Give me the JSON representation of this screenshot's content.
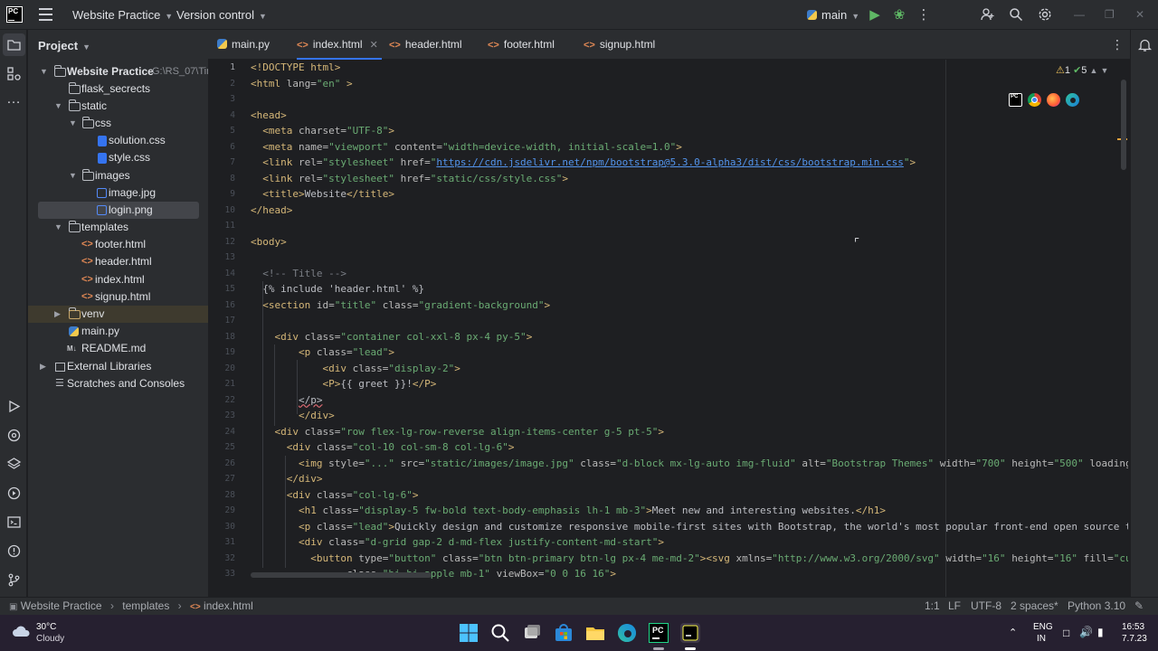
{
  "titlebar": {
    "app_logo": "PC",
    "project_name": "Website Practice",
    "vcs_label": "Version control",
    "run_config": "main",
    "icons": [
      "run-icon",
      "debug-icon",
      "more-vertical-icon",
      "add-user-icon",
      "search-icon",
      "settings-gear-icon"
    ]
  },
  "project_panel": {
    "title": "Project",
    "root": {
      "label": "Website Practice",
      "path": "G:\\RS_07\\Tim"
    },
    "items": [
      {
        "label": "flask_secrects",
        "kind": "folder"
      },
      {
        "label": "static",
        "kind": "folder"
      },
      {
        "label": "css",
        "kind": "folder"
      },
      {
        "label": "solution.css",
        "kind": "css"
      },
      {
        "label": "style.css",
        "kind": "css"
      },
      {
        "label": "images",
        "kind": "folder"
      },
      {
        "label": "image.jpg",
        "kind": "image"
      },
      {
        "label": "login.png",
        "kind": "image"
      },
      {
        "label": "templates",
        "kind": "folder"
      },
      {
        "label": "footer.html",
        "kind": "html"
      },
      {
        "label": "header.html",
        "kind": "html"
      },
      {
        "label": "index.html",
        "kind": "html"
      },
      {
        "label": "signup.html",
        "kind": "html"
      },
      {
        "label": "venv",
        "kind": "folder"
      },
      {
        "label": "main.py",
        "kind": "python"
      },
      {
        "label": "README.md",
        "kind": "markdown"
      },
      {
        "label": "External Libraries",
        "kind": "library"
      },
      {
        "label": "Scratches and Consoles",
        "kind": "scratch"
      }
    ]
  },
  "tabs": [
    {
      "label": "main.py",
      "kind": "python"
    },
    {
      "label": "index.html",
      "kind": "html",
      "active": true
    },
    {
      "label": "header.html",
      "kind": "html"
    },
    {
      "label": "footer.html",
      "kind": "html"
    },
    {
      "label": "signup.html",
      "kind": "html"
    }
  ],
  "inspections": {
    "warnings": "1",
    "ok": "5"
  },
  "editor_lines": [
    [
      [
        "tag",
        "<!DOCTYPE html>"
      ]
    ],
    [
      [
        "tag",
        "<html "
      ],
      [
        "at",
        "lang="
      ],
      [
        "st",
        "\"en\""
      ],
      [
        "tag",
        " >"
      ]
    ],
    [],
    [
      [
        "tag",
        "<head>"
      ]
    ],
    [
      [
        "tx",
        "  "
      ],
      [
        "tag",
        "<meta "
      ],
      [
        "at",
        "charset="
      ],
      [
        "st",
        "\"UTF-8\""
      ],
      [
        "tag",
        ">"
      ]
    ],
    [
      [
        "tx",
        "  "
      ],
      [
        "tag",
        "<meta "
      ],
      [
        "at",
        "name="
      ],
      [
        "st",
        "\"viewport\" "
      ],
      [
        "at",
        "content="
      ],
      [
        "st",
        "\"width=device-width, initial-scale=1.0\""
      ],
      [
        "tag",
        ">"
      ]
    ],
    [
      [
        "tx",
        "  "
      ],
      [
        "tag",
        "<link "
      ],
      [
        "at",
        "rel="
      ],
      [
        "st",
        "\"stylesheet\" "
      ],
      [
        "at",
        "href="
      ],
      [
        "st",
        "\""
      ],
      [
        "url",
        "https://cdn.jsdelivr.net/npm/bootstrap@5.3.0-alpha3/dist/css/bootstrap.min.css"
      ],
      [
        "st",
        "\""
      ],
      [
        "tag",
        ">"
      ]
    ],
    [
      [
        "tx",
        "  "
      ],
      [
        "tag",
        "<link "
      ],
      [
        "at",
        "rel="
      ],
      [
        "st",
        "\"stylesheet\" "
      ],
      [
        "at",
        "href="
      ],
      [
        "st",
        "\"static/css/style.css\""
      ],
      [
        "tag",
        ">"
      ]
    ],
    [
      [
        "tx",
        "  "
      ],
      [
        "tag",
        "<title>"
      ],
      [
        "tx",
        "Website"
      ],
      [
        "tag",
        "</title>"
      ]
    ],
    [
      [
        "tag",
        "</head>"
      ]
    ],
    [],
    [
      [
        "tag",
        "<body>"
      ]
    ],
    [],
    [
      [
        "cm",
        "  <!-- Title -->"
      ]
    ],
    [
      [
        "tmpl",
        "  {% include 'header.html' %}"
      ]
    ],
    [
      [
        "tx",
        "  "
      ],
      [
        "tag",
        "<section "
      ],
      [
        "at",
        "id="
      ],
      [
        "st",
        "\"title\" "
      ],
      [
        "at",
        "class="
      ],
      [
        "st",
        "\"gradient-background\""
      ],
      [
        "tag",
        ">"
      ]
    ],
    [],
    [
      [
        "tx",
        "    "
      ],
      [
        "tag",
        "<div "
      ],
      [
        "at",
        "class="
      ],
      [
        "st",
        "\"container col-xxl-8 px-4 py-5\""
      ],
      [
        "tag",
        ">"
      ]
    ],
    [
      [
        "tx",
        "        "
      ],
      [
        "tag",
        "<p "
      ],
      [
        "at",
        "class="
      ],
      [
        "st",
        "\"lead\""
      ],
      [
        "tag",
        ">"
      ]
    ],
    [
      [
        "tx",
        "            "
      ],
      [
        "tag",
        "<div "
      ],
      [
        "at",
        "class="
      ],
      [
        "st",
        "\"display-2\""
      ],
      [
        "tag",
        ">"
      ]
    ],
    [
      [
        "tx",
        "            "
      ],
      [
        "tag",
        "<P>"
      ],
      [
        "tx",
        "{{ greet }}!"
      ],
      [
        "tag",
        "</P>"
      ]
    ],
    [
      [
        "tx",
        "        "
      ],
      [
        "err",
        "</p>"
      ]
    ],
    [
      [
        "tx",
        "        "
      ],
      [
        "tag",
        "</div>"
      ]
    ],
    [
      [
        "tx",
        "    "
      ],
      [
        "tag",
        "<div "
      ],
      [
        "at",
        "class="
      ],
      [
        "st",
        "\"row flex-lg-row-reverse align-items-center g-5 pt-5\""
      ],
      [
        "tag",
        ">"
      ]
    ],
    [
      [
        "tx",
        "      "
      ],
      [
        "tag",
        "<div "
      ],
      [
        "at",
        "class="
      ],
      [
        "st",
        "\"col-10 col-sm-8 col-lg-6\""
      ],
      [
        "tag",
        ">"
      ]
    ],
    [
      [
        "tx",
        "        "
      ],
      [
        "tag",
        "<img "
      ],
      [
        "at",
        "style="
      ],
      [
        "st",
        "\"...\" "
      ],
      [
        "at",
        "src="
      ],
      [
        "st",
        "\"static/images/image.jpg\" "
      ],
      [
        "at",
        "class="
      ],
      [
        "st",
        "\"d-block mx-lg-auto img-fluid\" "
      ],
      [
        "at",
        "alt="
      ],
      [
        "st",
        "\"Bootstrap Themes\" "
      ],
      [
        "at",
        "width="
      ],
      [
        "st",
        "\"700\" "
      ],
      [
        "at",
        "height="
      ],
      [
        "st",
        "\"500\" "
      ],
      [
        "at",
        "loading="
      ],
      [
        "st",
        "\"laz"
      ]
    ],
    [
      [
        "tx",
        "      "
      ],
      [
        "tag",
        "</div>"
      ]
    ],
    [
      [
        "tx",
        "      "
      ],
      [
        "tag",
        "<div "
      ],
      [
        "at",
        "class="
      ],
      [
        "st",
        "\"col-lg-6\""
      ],
      [
        "tag",
        ">"
      ]
    ],
    [
      [
        "tx",
        "        "
      ],
      [
        "tag",
        "<h1 "
      ],
      [
        "at",
        "class="
      ],
      [
        "st",
        "\"display-5 fw-bold text-body-emphasis lh-1 mb-3\""
      ],
      [
        "tag",
        ">"
      ],
      [
        "tx",
        "Meet new and interesting websites."
      ],
      [
        "tag",
        "</h1>"
      ]
    ],
    [
      [
        "tx",
        "        "
      ],
      [
        "tag",
        "<p "
      ],
      [
        "at",
        "class="
      ],
      [
        "st",
        "\"lead\""
      ],
      [
        "tag",
        ">"
      ],
      [
        "tx",
        "Quickly design and customize responsive mobile-first sites with Bootstrap, the world's most popular front-end open source toolki"
      ]
    ],
    [
      [
        "tx",
        "        "
      ],
      [
        "tag",
        "<div "
      ],
      [
        "at",
        "class="
      ],
      [
        "st",
        "\"d-grid gap-2 d-md-flex justify-content-md-start\""
      ],
      [
        "tag",
        ">"
      ]
    ],
    [
      [
        "tx",
        "          "
      ],
      [
        "tag",
        "<button "
      ],
      [
        "at",
        "type="
      ],
      [
        "st",
        "\"button\" "
      ],
      [
        "at",
        "class="
      ],
      [
        "st",
        "\"btn btn-primary btn-lg px-4 me-md-2\""
      ],
      [
        "tag",
        "><svg "
      ],
      [
        "at",
        "xmlns="
      ],
      [
        "st",
        "\"http://www.w3.org/2000/svg\" "
      ],
      [
        "at",
        "width="
      ],
      [
        "st",
        "\"16\" "
      ],
      [
        "at",
        "height="
      ],
      [
        "st",
        "\"16\" "
      ],
      [
        "at",
        "fill="
      ],
      [
        "st",
        "\"current"
      ]
    ],
    [
      [
        "tx",
        "                "
      ],
      [
        "at",
        "class="
      ],
      [
        "st",
        "\"bi bi-apple mb-1\" "
      ],
      [
        "at",
        "viewBox="
      ],
      [
        "st",
        "\"0 0 16 16\""
      ],
      [
        "tag",
        ">"
      ]
    ]
  ],
  "statusbar": {
    "breadcrumb": [
      "Website Practice",
      "templates",
      "index.html"
    ],
    "position": "1:1",
    "line_sep": "LF",
    "encoding": "UTF-8",
    "indent": "2 spaces*",
    "interpreter": "Python 3.10"
  },
  "taskbar": {
    "weather_temp": "30°C",
    "weather_desc": "Cloudy",
    "lang": "ENG",
    "region": "IN",
    "time": "16:53",
    "date": "7.7.23"
  }
}
